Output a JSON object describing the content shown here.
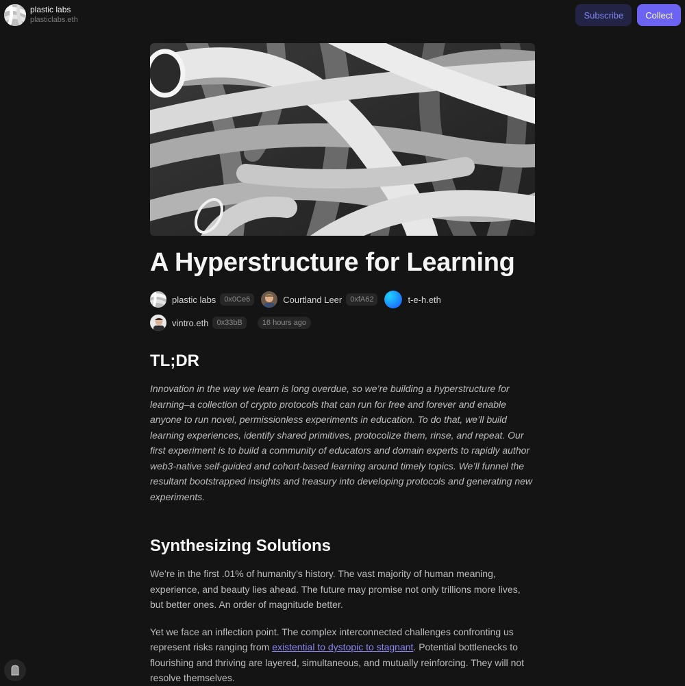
{
  "header": {
    "publication_name": "plastic labs",
    "publication_ens": "plasticlabs.eth",
    "subscribe_label": "Subscribe",
    "collect_label": "Collect"
  },
  "article": {
    "title": "A Hyperstructure for Learning",
    "authors_row1": [
      {
        "name": "plastic labs",
        "address": "0x0Ce6"
      },
      {
        "name": "Courtland Leer",
        "address": "0xfA62"
      },
      {
        "name": "t-e-h.eth",
        "address": ""
      }
    ],
    "authors_row2": [
      {
        "name": "vintro.eth",
        "address": "0x33bB"
      }
    ],
    "published": "16 hours ago",
    "tldr_heading": "TL;DR",
    "tldr_text": "Innovation in the way we learn is long overdue, so we’re building a hyperstructure for learning–a collection of crypto protocols that can run for free and forever and enable anyone to run novel, permissionless experiments in education. To do that, we’ll build learning experiences, identify shared primitives, protocolize them, rinse, and repeat. Our first experiment is to build a community of educators and domain experts to rapidly author web3-native self-guided and cohort-based learning around timely topics. We’ll funnel the resultant bootstrapped insights and treasury into developing protocols and generating new experiments.",
    "section_heading": "Synthesizing Solutions",
    "para1": "We’re in the first .01% of humanity’s history. The vast majority of human meaning, experience, and beauty lies ahead. The future may promise not only trillions more lives, but better ones. An order of magnitude better.",
    "para2_before": "Yet we face an inflection point. The complex interconnected challenges confronting us represent risks ranging from ",
    "para2_link": "existential to dystopic to stagnant",
    "para2_after": ". Potential bottlenecks to flourishing and thriving are layered, simultaneous, and mutually reinforcing. They will not resolve themselves."
  },
  "icons": {
    "hero": "abstract-white-tubes-image",
    "floating": "bookmark-icon"
  }
}
